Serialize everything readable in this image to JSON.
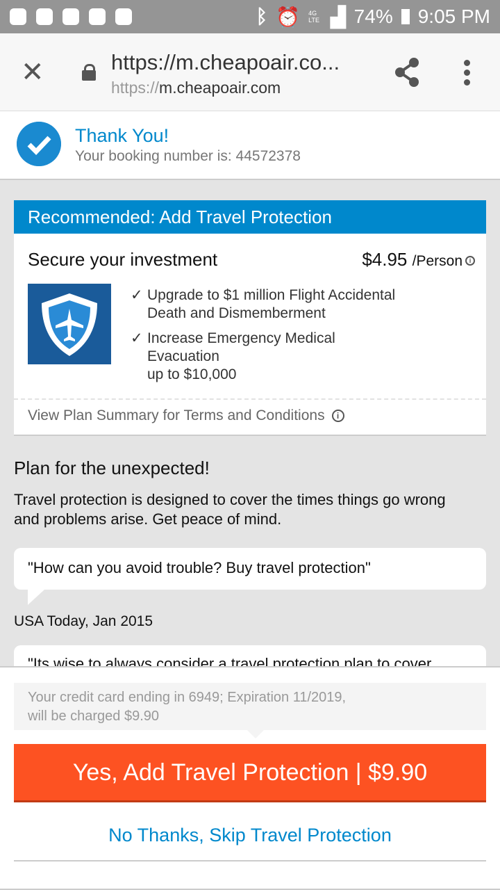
{
  "status_bar": {
    "battery": "74%",
    "time": "9:05 PM",
    "network": "4G LTE"
  },
  "browser": {
    "title": "https://m.cheapoair.co...",
    "url_scheme": "https://",
    "url_host": "m.cheapoair.com"
  },
  "confirmation": {
    "title": "Thank You!",
    "booking": "Your booking number is: 44572378"
  },
  "offer": {
    "header": "Recommended: Add Travel Protection",
    "headline": "Secure your investment",
    "price": "$4.95",
    "per": "/Person",
    "benefits": [
      "Upgrade to $1 million Flight Accidental",
      "Death and Dismemberment",
      "Increase Emergency Medical",
      "Evacuation",
      "up to $10,000"
    ],
    "terms": "View Plan Summary for Terms and Conditions"
  },
  "info": {
    "heading": "Plan for the unexpected!",
    "body": "Travel protection is designed to cover the times things go wrong and problems arise. Get peace of mind.",
    "quote1": "\"How can you avoid trouble? Buy travel protection\"",
    "source1": "USA Today, Jan 2015",
    "quote2": "\"Its wise to always consider a travel protection plan to cover"
  },
  "footer": {
    "charge_line1": "Your credit card ending in 6949; Expiration 11/2019,",
    "charge_line2": "will be charged $9.90",
    "yes_label": "Yes, Add Travel Protection | $9.90",
    "no_label": "No Thanks, Skip Travel Protection"
  },
  "colors": {
    "brand": "#0088cc",
    "cta": "#fd5222"
  }
}
